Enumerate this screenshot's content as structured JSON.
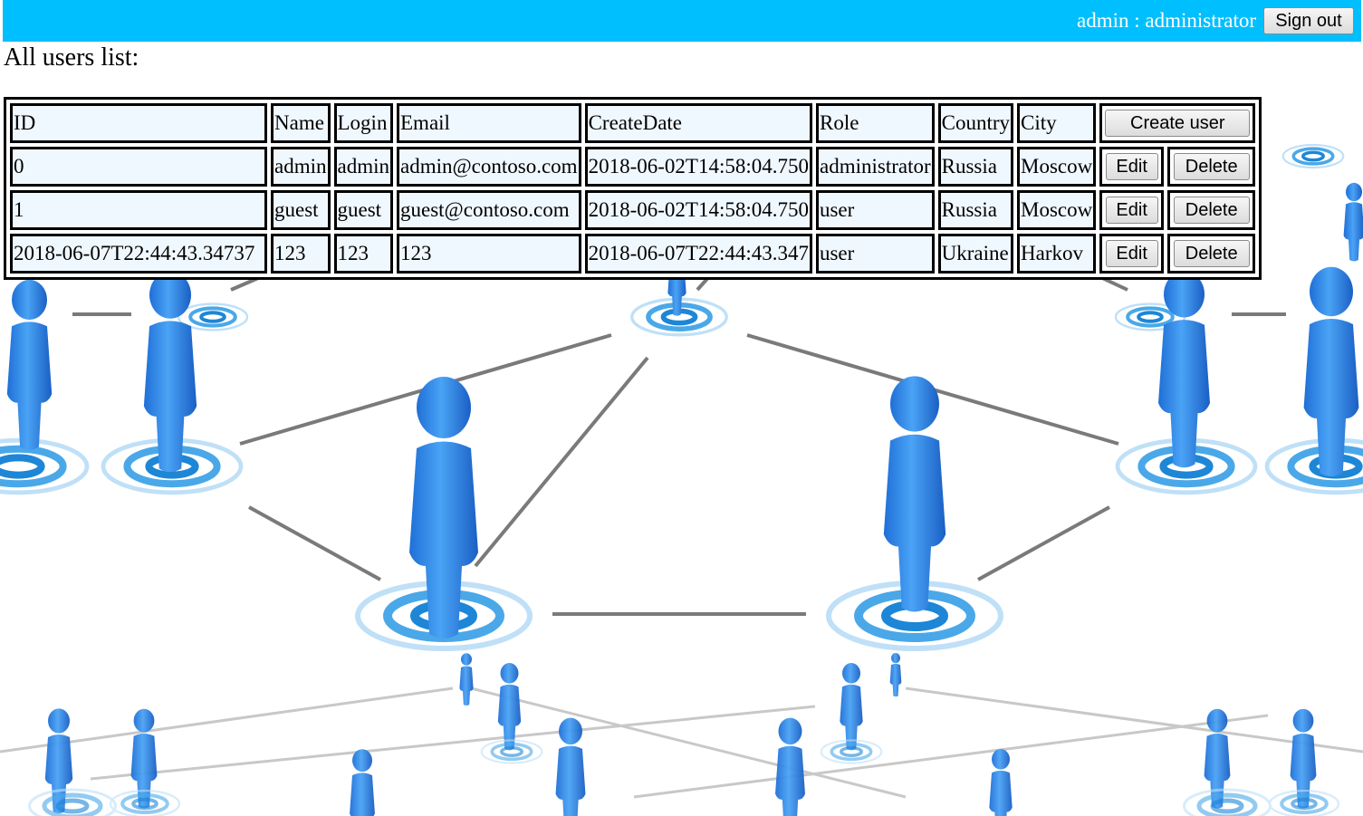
{
  "header": {
    "user_info": "admin : administrator",
    "sign_out_label": "Sign out"
  },
  "page_title": "All users list:",
  "table": {
    "columns": [
      "ID",
      "Name",
      "Login",
      "Email",
      "CreateDate",
      "Role",
      "Country",
      "City"
    ],
    "create_label": "Create user",
    "edit_label": "Edit",
    "delete_label": "Delete",
    "rows": [
      {
        "id": "0",
        "name": "admin",
        "login": "admin",
        "email": "admin@contoso.com",
        "create_date": "2018-06-02T14:58:04.750",
        "role": "administrator",
        "country": "Russia",
        "city": "Moscow"
      },
      {
        "id": "1",
        "name": "guest",
        "login": "guest",
        "email": "guest@contoso.com",
        "create_date": "2018-06-02T14:58:04.750",
        "role": "user",
        "country": "Russia",
        "city": "Moscow"
      },
      {
        "id": "2018-06-07T22:44:43.34737",
        "name": "123",
        "login": "123",
        "email": "123",
        "create_date": "2018-06-07T22:44:43.347",
        "role": "user",
        "country": "Ukraine",
        "city": "Harkov"
      }
    ]
  },
  "colors": {
    "topbar": "#00bfff",
    "cell_bg": "#f0f8ff",
    "figure_blue": "#2f86e8"
  }
}
